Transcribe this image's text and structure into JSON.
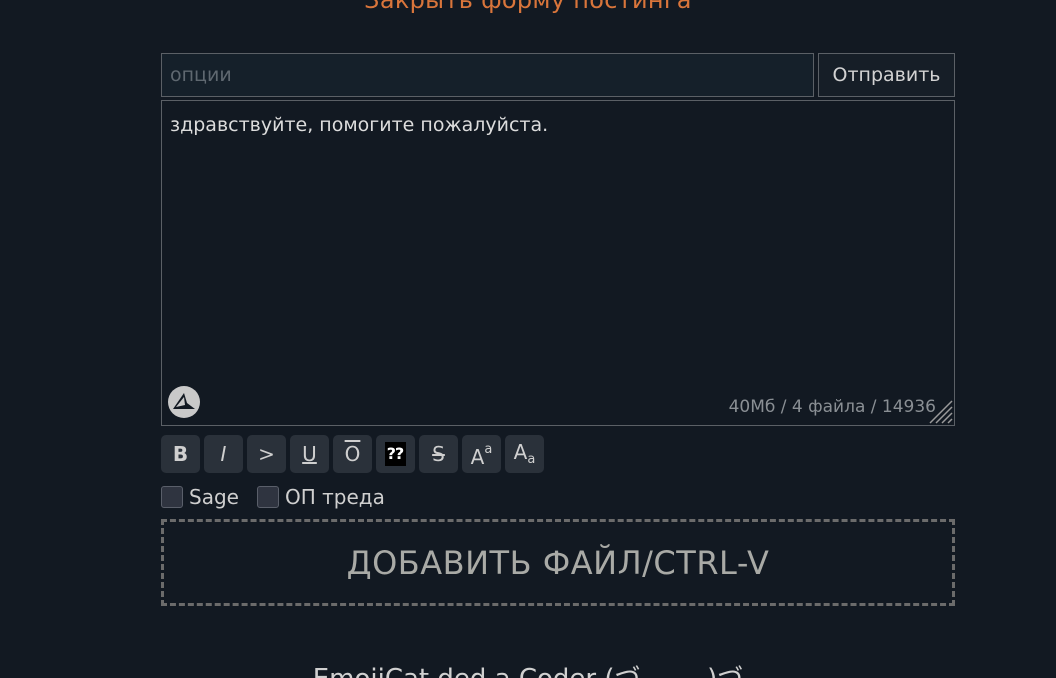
{
  "header": {
    "close_form_label": "Закрыть форму постинга"
  },
  "form": {
    "options_placeholder": "опции",
    "options_value": "",
    "submit_label": "Отправить",
    "message_text": "здравствуйте, помогите пожалуйста.",
    "counter": "40Мб / 4 файла / 14936"
  },
  "toolbar": {
    "bold": "B",
    "italic": "I",
    "quote": ">",
    "underline": "U",
    "overline": "O",
    "spoiler": "⁇",
    "strike": "S",
    "sup_big": "A",
    "sup_small": "a",
    "sub_big": "A",
    "sub_small": "a"
  },
  "checkboxes": [
    {
      "label": "Sage",
      "checked": false
    },
    {
      "label": "ОП треда",
      "checked": false
    }
  ],
  "dropzone": {
    "label": "ДОБАВИТЬ ФАЙЛ/CTRL-V"
  },
  "footer": {
    "text": "EmojiCat ded a Coder (づ ‿ ‿ )づ"
  },
  "icons": {
    "logo": "sailboat-logo-icon",
    "resize": "resize-grip-icon"
  },
  "colors": {
    "accent": "#d9753b",
    "background": "#121922",
    "button": "#2a313a"
  }
}
